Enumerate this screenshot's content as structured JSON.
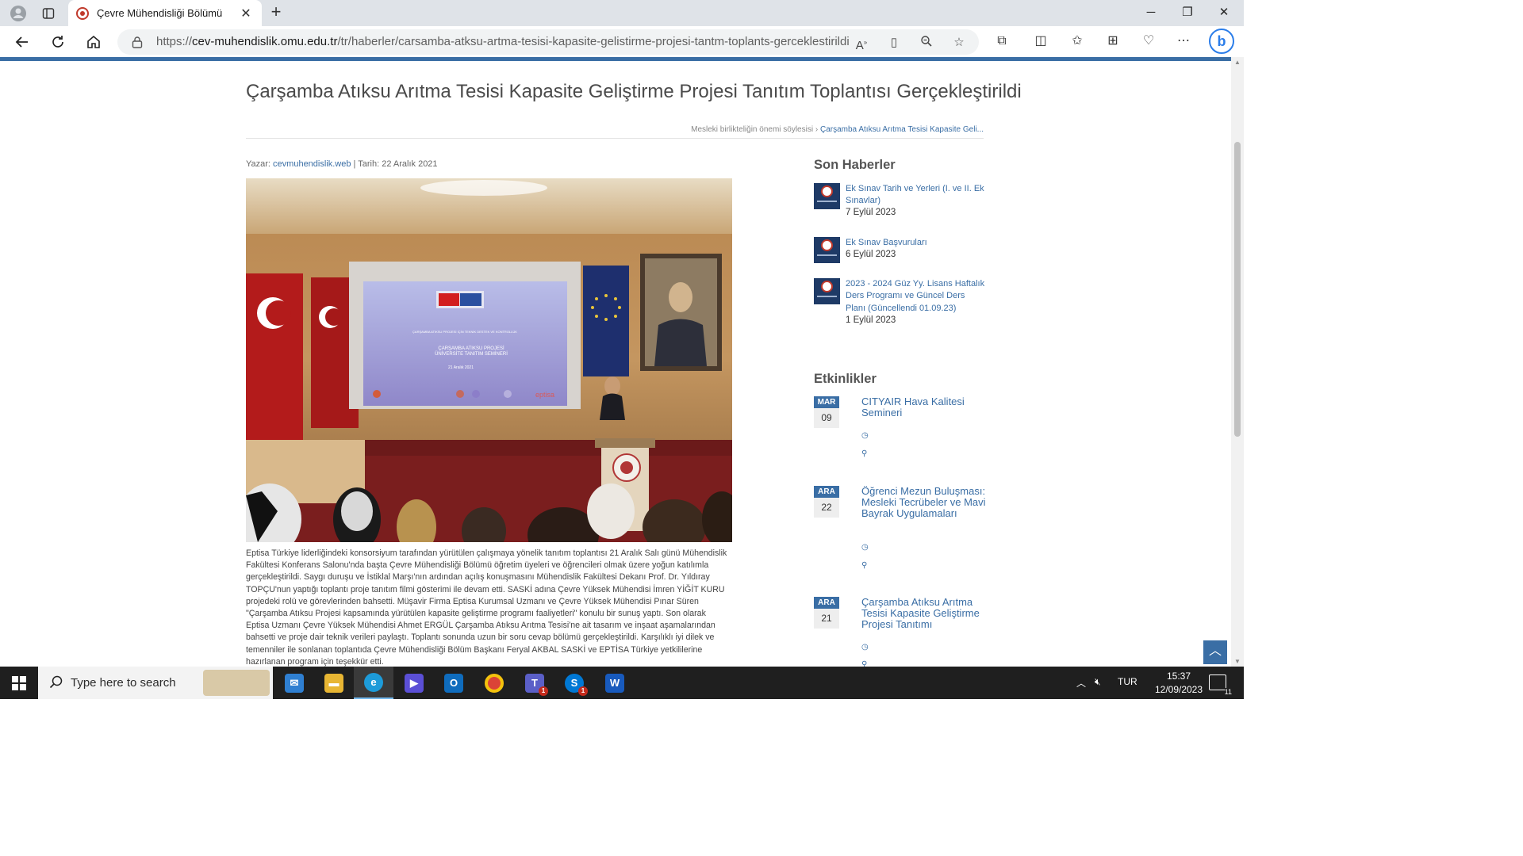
{
  "browser": {
    "tab_title": "Çevre Mühendisliği Bölümü",
    "url_prefix": "https://",
    "url_host": "cev-muhendislik.omu.edu.tr",
    "url_path": "/tr/haberler/carsamba-atksu-artma-tesisi-kapasite-gelistirme-projesi-tantm-toplants-gerceklestirildi",
    "icons": [
      "profile-icon",
      "tab-actions-icon",
      "close-icon",
      "plus-icon",
      "back-icon",
      "refresh-icon",
      "home-icon",
      "lock-icon",
      "read-aloud-icon",
      "immersive-reader-icon",
      "zoom-icon",
      "favorite-star-icon",
      "extensions-icon",
      "split-screen-icon",
      "favorites-icon",
      "collections-icon",
      "performance-icon",
      "more-icon",
      "bing-icon"
    ]
  },
  "article": {
    "title": "Çarşamba Atıksu Arıtma Tesisi Kapasite Geliştirme Projesi Tanıtım Toplantısı Gerçekleştirildi",
    "breadcrumb_prev": "Mesleki birlikteliğin önemi söylesisi",
    "breadcrumb_sep": "›",
    "breadcrumb_current": "Çarşamba Atıksu Arıtma Tesisi Kapasite Geli...",
    "author_label": "Yazar:",
    "author": "cevmuhendislik.web",
    "date_label": "| Tarih: 22 Aralık 2021",
    "body": "Eptisa Türkiye liderliğindeki konsorsiyum tarafından yürütülen çalışmaya yönelik tanıtım toplantısı 21 Aralık Salı günü Mühendislik Fakültesi Konferans Salonu'nda başta Çevre Mühendisliği Bölümü öğretim üyeleri ve öğrencileri olmak üzere yoğun katılımla gerçekleştirildi. Saygı duruşu ve İstiklal Marşı'nın ardından açılış konuşmasını Mühendislik Fakültesi Dekanı Prof. Dr. Yıldıray TOPÇU'nun yaptığı toplantı proje tanıtım filmi gösterimi ile devam etti. SASKİ adına Çevre Yüksek Mühendisi İmren YİĞİT KURU projedeki rolü ve görevlerinden bahsetti. Müşavir Firma Eptisa Kurumsal Uzmanı ve Çevre Yüksek Mühendisi Pınar Süren \"Çarşamba Atıksu Projesi kapsamında yürütülen kapasite geliştirme programı faaliyetleri\" konulu bir sunuş yaptı. Son olarak Eptisa Uzmanı Çevre Yüksek Mühendisi Ahmet ERGÜL Çarşamba Atıksu Arıtma Tesisi'ne ait tasarım ve inşaat aşamalarından bahsetti ve proje dair teknik verileri paylaştı. Toplantı sonunda uzun bir soru cevap bölümü gerçekleştirildi. Karşılıklı iyi dilek ve temenniler ile sonlanan toplantıda Çevre Mühendisliği Bölüm Başkanı Feryal AKBAL SASKİ ve EPTİSA Türkiye yetkililerine hazırlanan program için teşekkür etti."
  },
  "slide": {
    "line1": "ÇARŞAMBA ATIKSU PROJESİ İÇİN TEKNİK DESTEK VE KONTROLLÜK",
    "line2": "ÇARŞAMBA ATIKSU PROJESİ",
    "line3": "ÜNİVERSİTE TANITIM SEMİNERİ",
    "date": "21 Aralık 2021",
    "logo": "eptisa"
  },
  "sidebar": {
    "news_heading": "Son Haberler",
    "news": [
      {
        "title": "Ek Sınav Tarih ve Yerleri (I. ve II. Ek Sınavlar)",
        "date": "7 Eylül 2023"
      },
      {
        "title": "Ek Sınav Başvuruları",
        "date": "6 Eylül 2023"
      },
      {
        "title": "2023 - 2024 Güz Yy. Lisans Haftalık Ders Programı ve Güncel Ders Planı (Güncellendi 01.09.23)",
        "date": "1 Eylül 2023"
      }
    ],
    "events_heading": "Etkinlikler",
    "events": [
      {
        "month": "MAR",
        "day": "09",
        "title": "CITYAIR Hava Kalitesi Semineri"
      },
      {
        "month": "ARA",
        "day": "22",
        "title": "Öğrenci Mezun Buluşması: Mesleki Tecrübeler ve Mavi Bayrak Uygulamaları"
      },
      {
        "month": "ARA",
        "day": "21",
        "title": "Çarşamba Atıksu Arıtma Tesisi Kapasite Geliştirme Projesi Tanıtımı"
      }
    ]
  },
  "taskbar": {
    "search_placeholder": "Type here to search",
    "lang": "TUR",
    "time": "15:37",
    "date": "12/09/2023",
    "notification_count": "11",
    "teams_badge": "1",
    "skype_badge": "1",
    "apps": [
      "mail-icon",
      "file-explorer-icon",
      "edge-icon",
      "video-editor-icon",
      "outlook-icon",
      "chrome-icon",
      "teams-icon",
      "skype-icon",
      "word-icon"
    ]
  },
  "colors": {
    "accent": "#3a6ea5",
    "heading": "#4a4a4a",
    "body_text": "#444444"
  }
}
